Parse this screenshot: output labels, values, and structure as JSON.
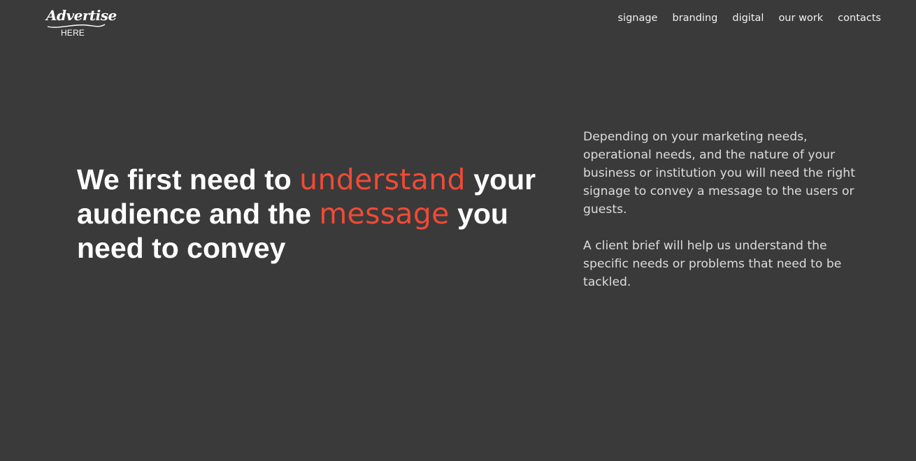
{
  "logo": {
    "script_text": "Advertise",
    "sub_text": "HERE"
  },
  "nav": {
    "items": [
      "signage",
      "branding",
      "digital",
      "our work",
      "contacts"
    ]
  },
  "hero": {
    "headline_part1": "We first need to ",
    "headline_accent1": "understand",
    "headline_part2": " your audience and the ",
    "headline_accent2": "message",
    "headline_part3": " you need to convey"
  },
  "description": {
    "paragraph1": "Depending on your marketing needs, operational needs, and the nature of your business or institution you will need the right signage to convey a message to the users or guests.",
    "paragraph2": "A client brief will help us understand the specific needs or problems that need to be tackled."
  },
  "colors": {
    "background": "#3a3a3a",
    "accent": "#f14a36",
    "text": "#ffffff",
    "body_text": "#dcdcdc"
  }
}
